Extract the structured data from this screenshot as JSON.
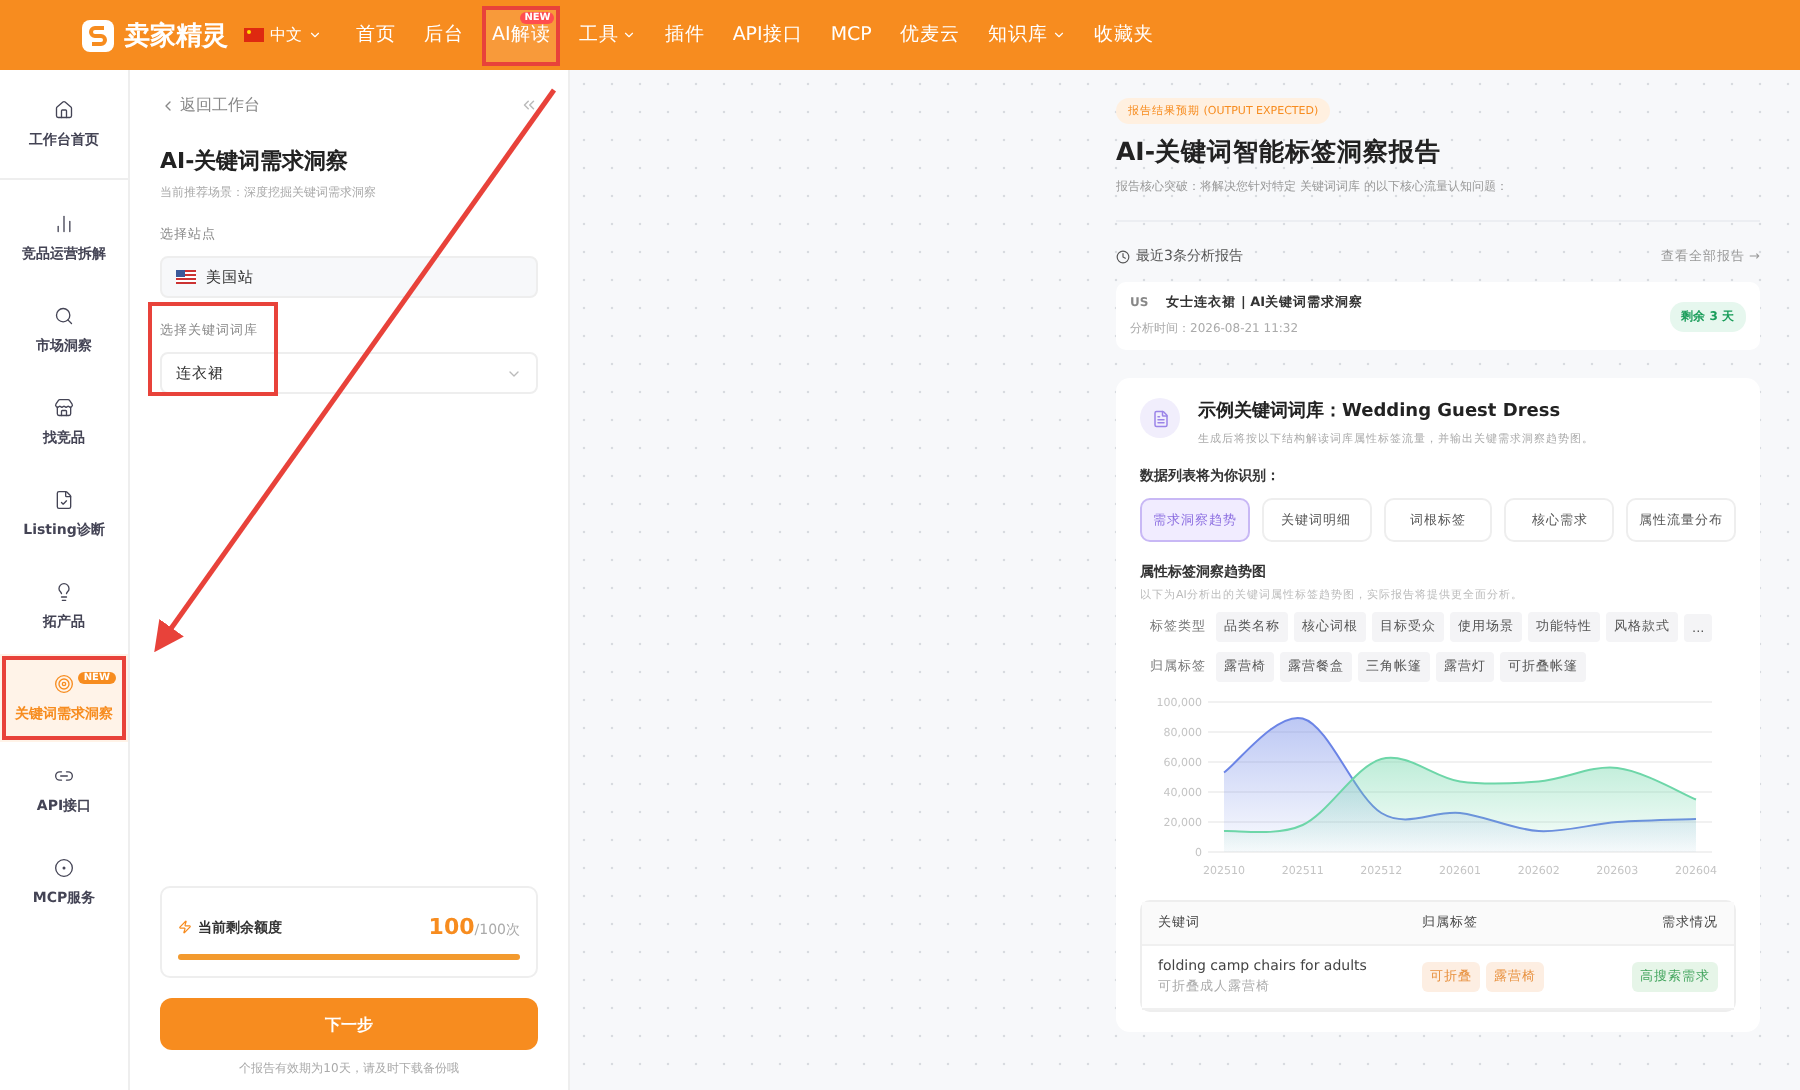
{
  "top_nav": {
    "logo": "卖家精灵",
    "language": "中文",
    "items": [
      {
        "label": "首页",
        "selected": false,
        "dropdown": false
      },
      {
        "label": "后台",
        "selected": false,
        "dropdown": false
      },
      {
        "label": "AI解读",
        "selected": true,
        "dropdown": false,
        "badge": "NEW"
      },
      {
        "label": "工具",
        "selected": false,
        "dropdown": true
      },
      {
        "label": "插件",
        "selected": false,
        "dropdown": false
      },
      {
        "label": "API接口",
        "selected": false,
        "dropdown": false
      },
      {
        "label": "MCP",
        "selected": false,
        "dropdown": false
      },
      {
        "label": "优麦云",
        "selected": false,
        "dropdown": false
      },
      {
        "label": "知识库",
        "selected": false,
        "dropdown": true
      },
      {
        "label": "收藏夹",
        "selected": false,
        "dropdown": false
      }
    ]
  },
  "sidebar": {
    "items": [
      {
        "label": "工作台首页",
        "selected": false
      },
      {
        "label": "竞品运营拆解",
        "selected": false
      },
      {
        "label": "市场洞察",
        "selected": false
      },
      {
        "label": "找竞品",
        "selected": false
      },
      {
        "label": "Listing诊断",
        "selected": false
      },
      {
        "label": "拓产品",
        "selected": false
      },
      {
        "label": "关键词需求洞察",
        "selected": true,
        "badge": "NEW"
      },
      {
        "label": "API接口",
        "selected": false
      },
      {
        "label": "MCP服务",
        "selected": false
      }
    ]
  },
  "form_panel": {
    "back_link": "返回工作台",
    "title": "AI-关键词需求洞察",
    "subtitle": "当前推荐场景：深度挖掘关键词需求洞察",
    "fields": [
      {
        "label": "选择站点",
        "value": "美国站",
        "kind": "flag"
      },
      {
        "label": "选择关键词词库",
        "value": "连衣裙",
        "kind": "select"
      }
    ],
    "quota": {
      "label": "当前剩余额度",
      "value": "100",
      "total": "/100次",
      "level": 1.0
    },
    "next_button": "下一步",
    "footnote": "个报告有效期为10天，请及时下载备份哦"
  },
  "report": {
    "badge": "报告结果预期 (OUTPUT EXPECTED)",
    "title": "AI-关键词智能标签洞察报告",
    "subtitle": "报告核心突破：将解决您针对特定 关键词词库 的以下核心流量认知问题：",
    "recent_title": "最近3条分析报告",
    "view_all": "查看全部报告 →",
    "recent": [
      {
        "site": "US",
        "name": "女士连衣裙 | AI关键词需求洞察",
        "time": "分析时间：2026-08-21 11:32",
        "remaining": "剩余 3 天"
      }
    ],
    "sample": {
      "title": "示例关键词词库：Wedding Guest Dress",
      "desc": "生成后将按以下结构解读词库属性标签流量，并输出关键需求洞察趋势图。",
      "list_title": "数据列表将为你识别：",
      "tabs": [
        {
          "label": "需求洞察趋势",
          "selected": true
        },
        {
          "label": "关键词明细",
          "selected": false
        },
        {
          "label": "词根标签",
          "selected": false
        },
        {
          "label": "核心需求",
          "selected": false
        },
        {
          "label": "属性流量分布",
          "selected": false
        }
      ],
      "chart_title": "属性标签洞察趋势图",
      "chart_desc": "以下为AI分析出的关键词属性标签趋势图，实际报告将提供更全面分析。",
      "tag_rows": [
        {
          "label": "标签类型",
          "tags": [
            "品类名称",
            "核心词根",
            "目标受众",
            "使用场景",
            "功能特性",
            "风格款式",
            "..."
          ]
        },
        {
          "label": "归属标签",
          "tags": [
            "露营椅",
            "露营餐盒",
            "三角帐篷",
            "露营灯",
            "可折叠帐篷"
          ]
        }
      ],
      "chart_data": {
        "type": "area",
        "grid": true,
        "categories": [
          "202510",
          "202511",
          "202512",
          "202601",
          "202602",
          "202603",
          "202604"
        ],
        "yticks": [
          0,
          {
            "value": 20000,
            "label": "20,000"
          },
          {
            "value": 40000,
            "label": "40,000"
          },
          {
            "value": 60000,
            "label": "60,000"
          },
          {
            "value": 80000,
            "label": "80,000"
          },
          {
            "value": 100000,
            "label": "100,000"
          }
        ],
        "ylim": [
          0,
          100000
        ],
        "series": [
          {
            "color": "#6b84e6",
            "values": [
              53000,
              89000,
              26000,
              26000,
              14000,
              20000,
              22000
            ]
          },
          {
            "color": "#6dd6a8",
            "values": [
              14000,
              18000,
              62000,
              47000,
              47000,
              56000,
              35000
            ]
          }
        ]
      },
      "table": {
        "columns": [
          "关键词",
          "归属标签",
          "需求情况"
        ],
        "rows": [
          {
            "keyword": "folding camp chairs for adults",
            "translation": "可折叠成人露营椅",
            "tags": [
              "可折叠",
              "露营椅"
            ],
            "demand": "高搜索需求"
          }
        ]
      }
    }
  }
}
